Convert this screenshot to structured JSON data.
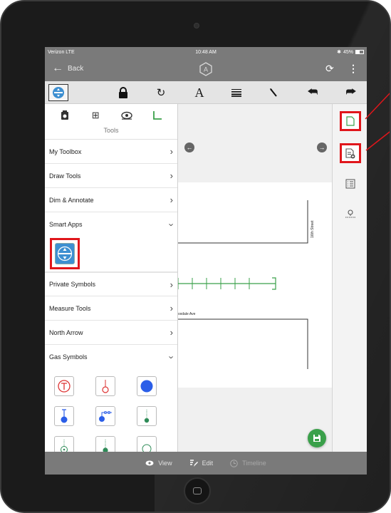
{
  "status_bar": {
    "carrier": "Verizon  LTE",
    "time": "10:48 AM",
    "battery": "45%"
  },
  "nav_bar": {
    "back_label": "Back"
  },
  "panel": {
    "title": "Tools",
    "menu_items": [
      {
        "label": "My Toolbox",
        "state": "collapsed"
      },
      {
        "label": "Draw Tools",
        "state": "collapsed"
      },
      {
        "label": "Dim & Annotate",
        "state": "collapsed"
      },
      {
        "label": "Smart Apps",
        "state": "expanded"
      },
      {
        "label": "Private Symbols",
        "state": "collapsed"
      },
      {
        "label": "Measure Tools",
        "state": "collapsed"
      },
      {
        "label": "North Arrow",
        "state": "collapsed"
      },
      {
        "label": "Gas Symbols",
        "state": "expanded"
      }
    ]
  },
  "canvas": {
    "street_vertical": "16th Street",
    "street_horizontal": "oxdale Ave"
  },
  "bottom_bar": {
    "view": "View",
    "edit": "Edit",
    "timeline": "Timeline"
  },
  "colors": {
    "highlight": "#e0161b",
    "bar_gray": "#7a7a7a",
    "save_green": "#3aa04a",
    "app_blue": "#3d8fd1"
  }
}
